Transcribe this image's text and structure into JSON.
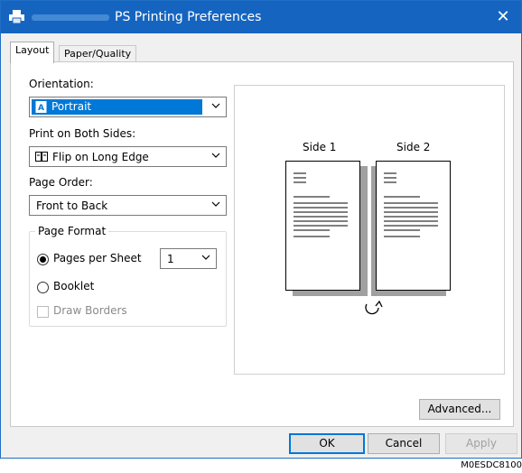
{
  "window": {
    "title": "PS Printing Preferences",
    "close_glyph": "✕",
    "app_icon": "printer-icon"
  },
  "tabs": [
    {
      "label": "Layout",
      "active": true
    },
    {
      "label": "Paper/Quality",
      "active": false
    }
  ],
  "layout": {
    "orientation": {
      "label": "Orientation:",
      "value": "Portrait",
      "icon": "portrait-page-icon"
    },
    "both_sides": {
      "label": "Print on Both Sides:",
      "value": "Flip on Long Edge",
      "icon": "book-flip-icon"
    },
    "page_order": {
      "label": "Page Order:",
      "value": "Front to Back"
    },
    "page_format": {
      "legend": "Page Format",
      "pages_per_sheet": {
        "label": "Pages per Sheet",
        "selected": true,
        "value": "1"
      },
      "booklet": {
        "label": "Booklet",
        "selected": false
      },
      "draw_borders": {
        "label": "Draw Borders",
        "checked": false,
        "enabled": false
      }
    }
  },
  "preview": {
    "side1": "Side 1",
    "side2": "Side 2",
    "flip_icon": "rotate-arrow-icon"
  },
  "buttons": {
    "advanced": "Advanced...",
    "ok": "OK",
    "cancel": "Cancel",
    "apply": "Apply"
  },
  "image_code": "M0ESDC8100"
}
